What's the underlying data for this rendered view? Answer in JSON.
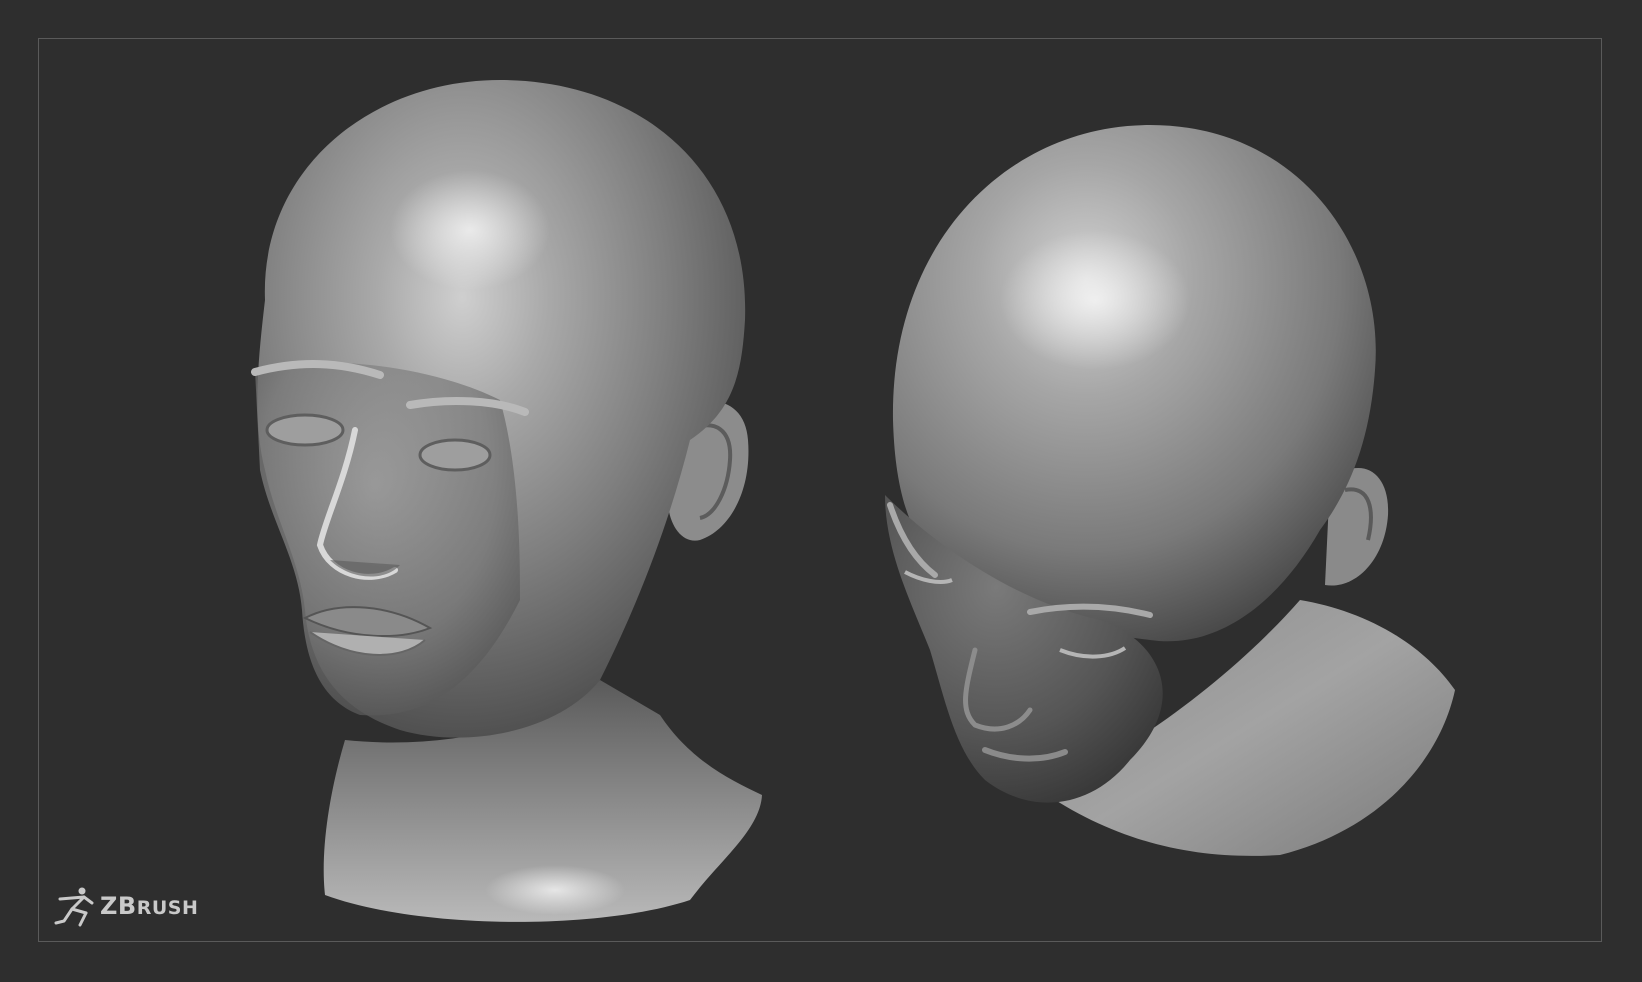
{
  "scene": {
    "background_color": "#2e2e2e",
    "frame_color": "#5a5a5a",
    "subjects": [
      {
        "name": "head-sculpt-front-three-quarter"
      },
      {
        "name": "head-sculpt-top-down"
      }
    ]
  },
  "logo": {
    "icon": "zbrush-figure-icon",
    "text_prefix": "ZB",
    "text_suffix": "RUSH"
  }
}
